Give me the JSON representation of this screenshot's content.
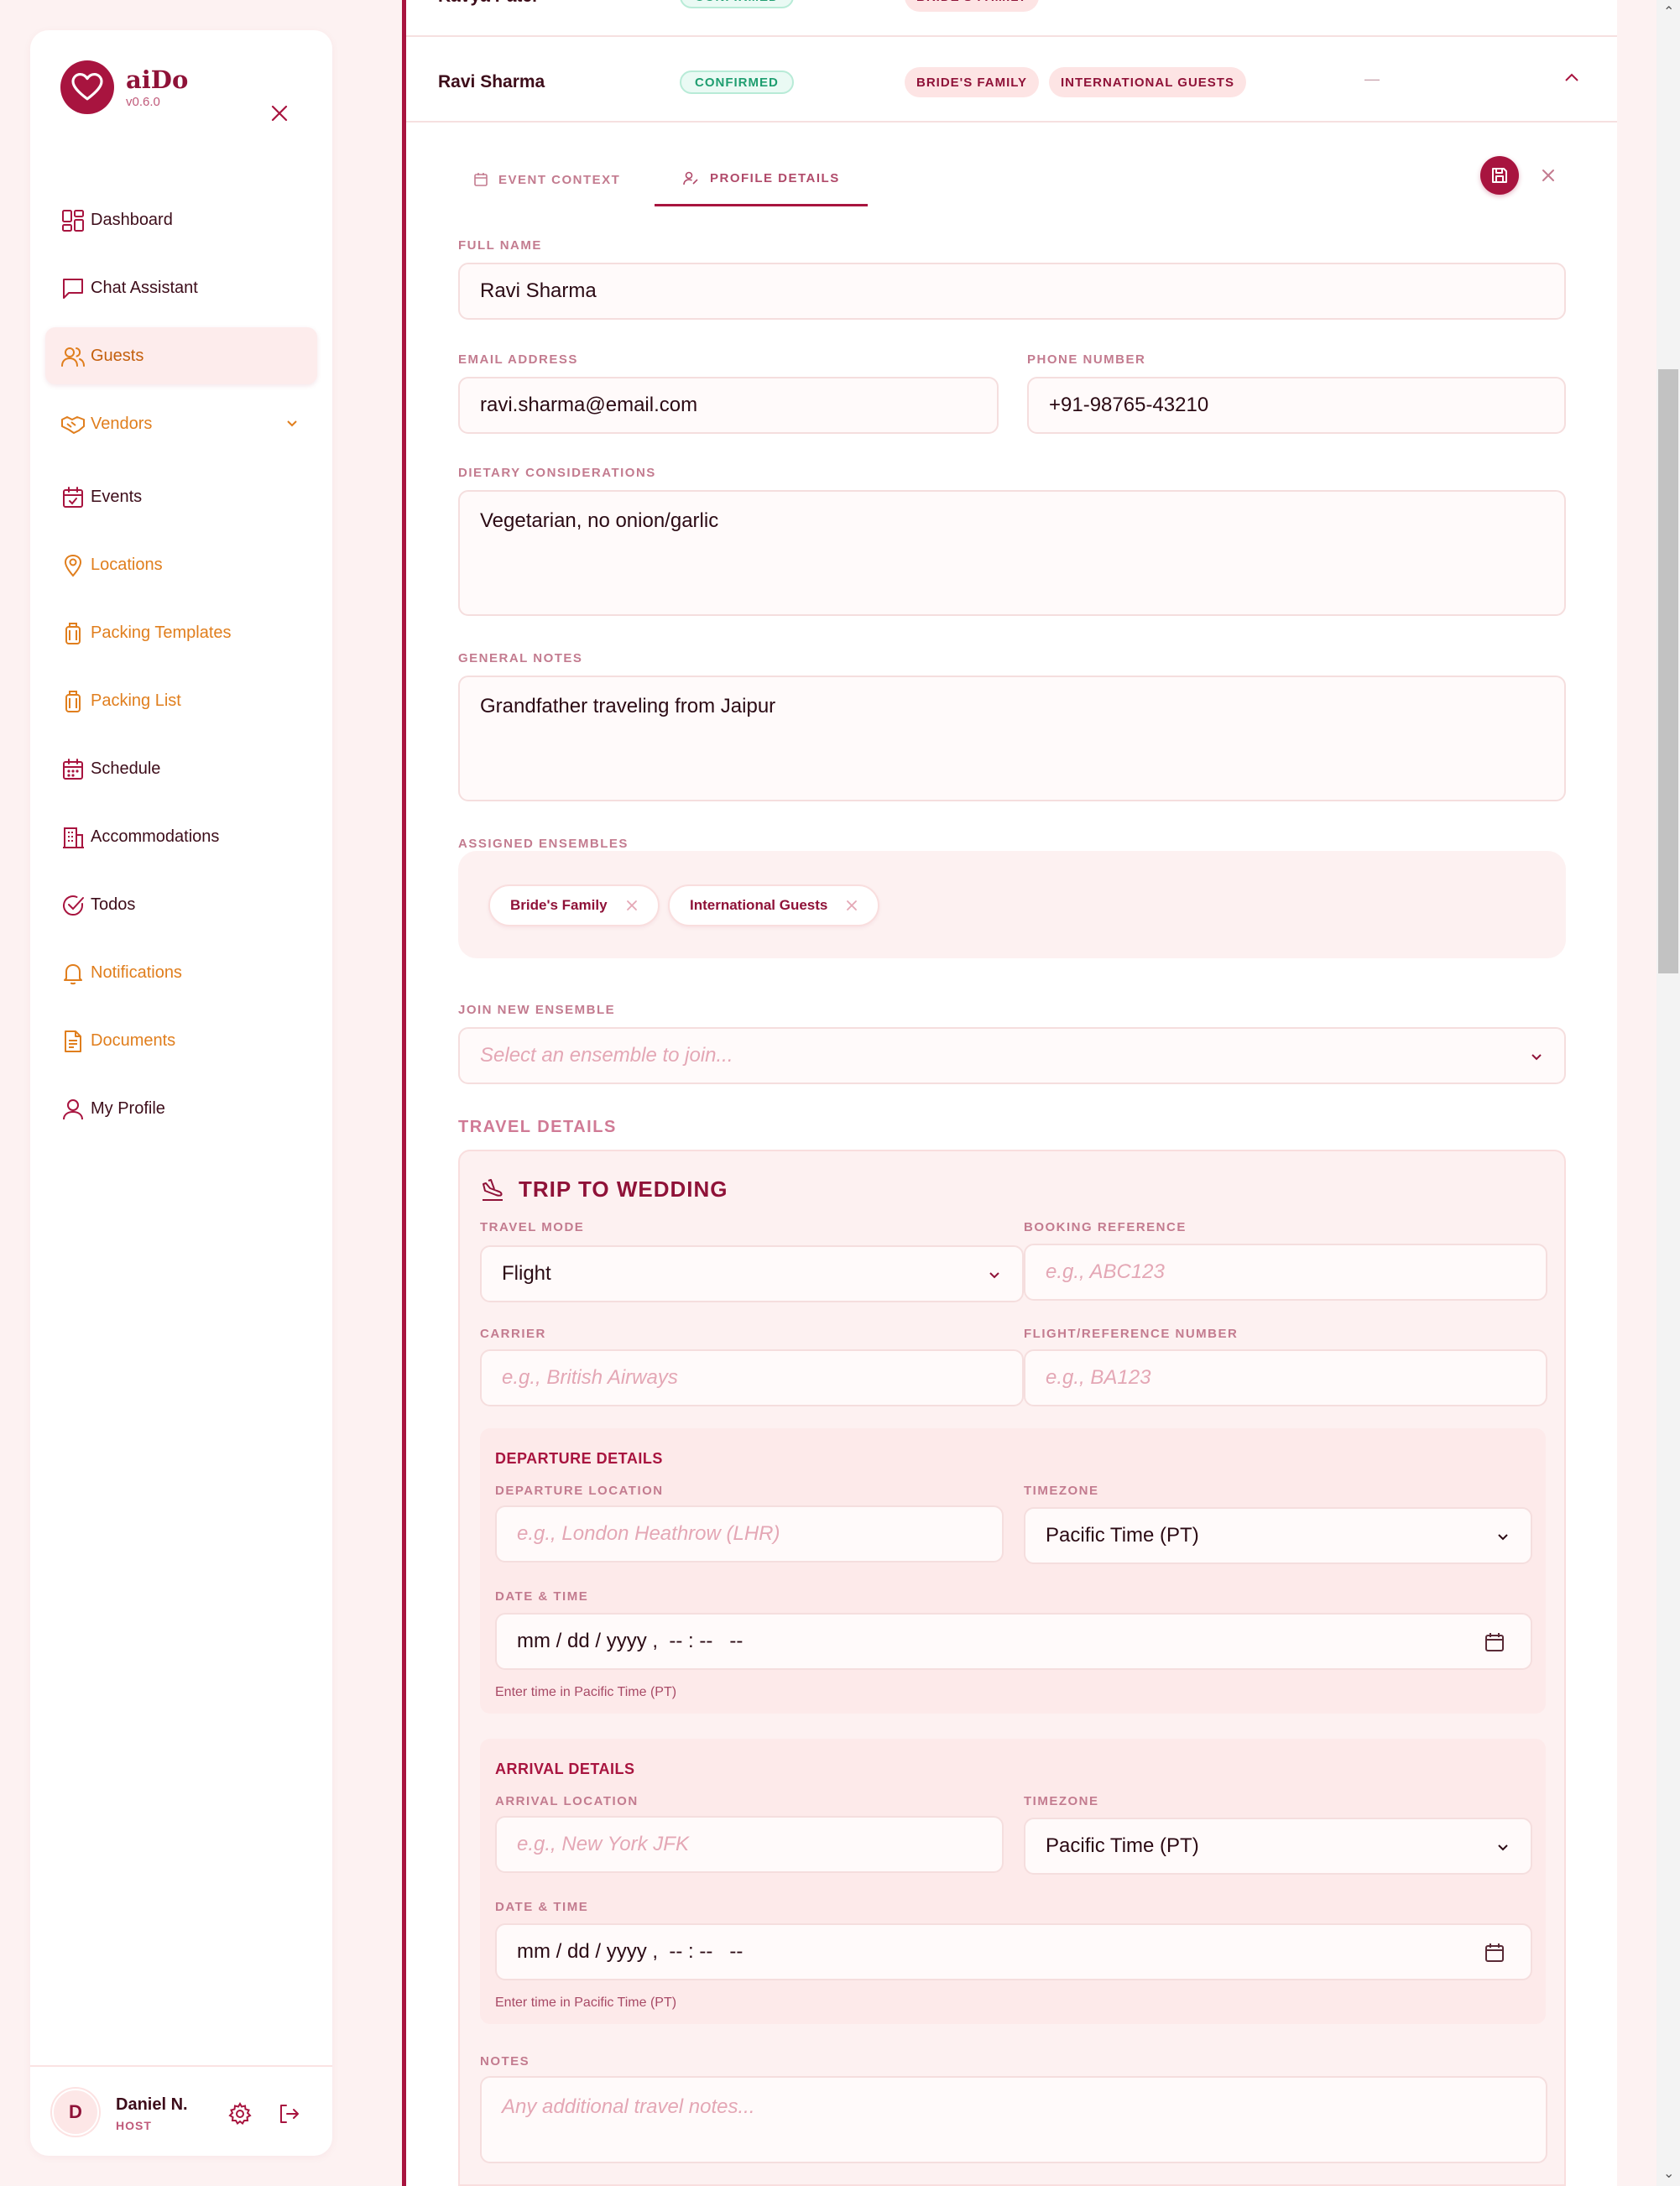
{
  "app": {
    "name": "aiDo",
    "version": "v0.6.0"
  },
  "sidebar": {
    "items": [
      {
        "label": "Dashboard",
        "icon": "dashboard-icon"
      },
      {
        "label": "Chat Assistant",
        "icon": "chat-icon"
      },
      {
        "label": "Guests",
        "icon": "users-icon",
        "active": true
      },
      {
        "label": "Vendors",
        "icon": "handshake-icon",
        "expandable": true
      },
      {
        "label": "Events",
        "icon": "calendar-check-icon"
      },
      {
        "label": "Locations",
        "icon": "map-pin-icon"
      },
      {
        "label": "Packing Templates",
        "icon": "luggage-icon"
      },
      {
        "label": "Packing List",
        "icon": "luggage-icon"
      },
      {
        "label": "Schedule",
        "icon": "calendar-grid-icon"
      },
      {
        "label": "Accommodations",
        "icon": "building-icon"
      },
      {
        "label": "Todos",
        "icon": "check-circle-icon"
      },
      {
        "label": "Notifications",
        "icon": "bell-icon"
      },
      {
        "label": "Documents",
        "icon": "document-icon"
      },
      {
        "label": "My Profile",
        "icon": "user-icon"
      }
    ],
    "user": {
      "initial": "D",
      "name": "Daniel N.",
      "role": "HOST"
    }
  },
  "guest_rows": [
    {
      "name": "Kavya Patel",
      "status": "CONFIRMED",
      "tags": [
        "BRIDE'S FAMILY"
      ],
      "dash": "—"
    },
    {
      "name": "Ravi Sharma",
      "status": "CONFIRMED",
      "tags": [
        "BRIDE'S FAMILY",
        "INTERNATIONAL GUESTS"
      ],
      "dash": "—"
    }
  ],
  "detail": {
    "tabs": [
      {
        "label": "EVENT CONTEXT",
        "icon": "calendar-icon"
      },
      {
        "label": "PROFILE DETAILS",
        "icon": "user-edit-icon",
        "active": true
      }
    ],
    "full_name": {
      "label": "FULL NAME",
      "value": "Ravi Sharma"
    },
    "email": {
      "label": "EMAIL ADDRESS",
      "value": "ravi.sharma@email.com"
    },
    "phone": {
      "label": "PHONE NUMBER",
      "value": "+91-98765-43210"
    },
    "dietary": {
      "label": "DIETARY CONSIDERATIONS",
      "value": "Vegetarian, no onion/garlic"
    },
    "notes": {
      "label": "GENERAL NOTES",
      "value": "Grandfather traveling from Jaipur"
    },
    "ensembles": {
      "label": "ASSIGNED ENSEMBLES",
      "chips": [
        "Bride's Family",
        "International Guests"
      ]
    },
    "join_ensemble": {
      "label": "JOIN NEW ENSEMBLE",
      "placeholder": "Select an ensemble to join..."
    }
  },
  "travel": {
    "section_title": "TRAVEL DETAILS",
    "trip_title": "TRIP TO WEDDING",
    "travel_mode": {
      "label": "TRAVEL MODE",
      "value": "Flight"
    },
    "booking_ref": {
      "label": "BOOKING REFERENCE",
      "placeholder": "e.g., ABC123"
    },
    "carrier": {
      "label": "CARRIER",
      "placeholder": "e.g., British Airways"
    },
    "flight_number": {
      "label": "FLIGHT/REFERENCE NUMBER",
      "placeholder": "e.g., BA123"
    },
    "departure": {
      "title": "DEPARTURE DETAILS",
      "location_label": "DEPARTURE LOCATION",
      "location_placeholder": "e.g., London Heathrow (LHR)",
      "timezone_label": "TIMEZONE",
      "timezone_value": "Pacific Time (PT)",
      "datetime_label": "DATE & TIME",
      "datetime_value": "mm / dd / yyyy ,  -- : --   --",
      "hint": "Enter time in Pacific Time (PT)"
    },
    "arrival": {
      "title": "ARRIVAL DETAILS",
      "location_label": "ARRIVAL LOCATION",
      "location_placeholder": "e.g., New York JFK",
      "timezone_label": "TIMEZONE",
      "timezone_value": "Pacific Time (PT)",
      "datetime_label": "DATE & TIME",
      "datetime_value": "mm / dd / yyyy ,  -- : --   --",
      "hint": "Enter time in Pacific Time (PT)"
    },
    "notes": {
      "label": "NOTES",
      "placeholder": "Any additional travel notes..."
    }
  },
  "colors": {
    "brand": "#a8143f",
    "nav_orange": "#e07e1d",
    "label_pink": "#c37b8f",
    "status_green": "#1f9e70",
    "page_bg": "#fdf2f2"
  }
}
